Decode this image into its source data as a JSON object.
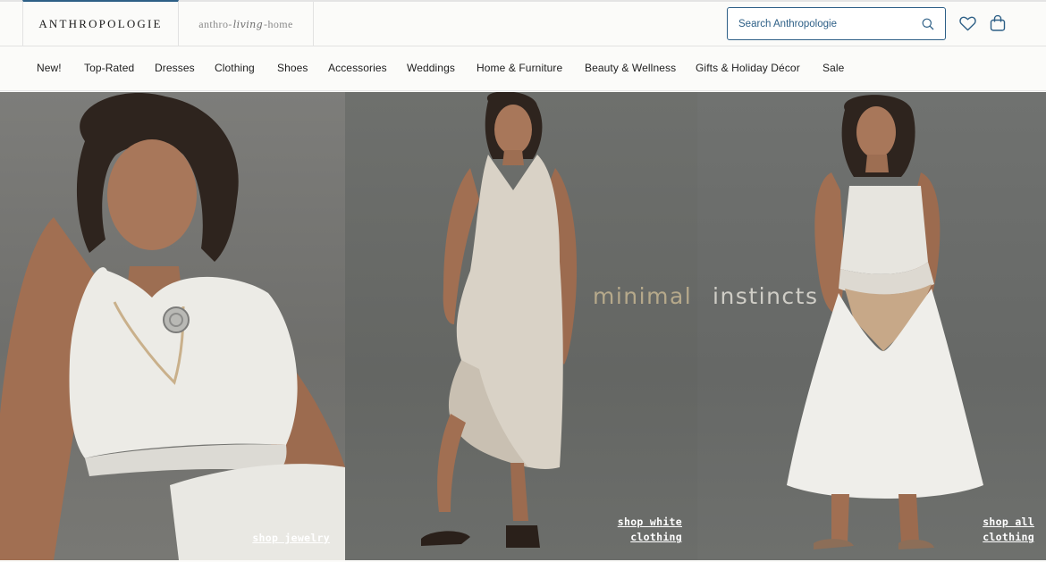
{
  "header": {
    "brand_primary": "ANTHROPOLOGIE",
    "brand_secondary_pre": "anthro-",
    "brand_secondary_script": "living",
    "brand_secondary_post": "-home",
    "search_placeholder": "Search Anthropologie",
    "icons": {
      "search": "search-icon",
      "wishlist": "heart-icon",
      "cart": "shopping-bag-icon"
    },
    "accent_color": "#2d5f86"
  },
  "nav": {
    "items": [
      "New!",
      "Top-Rated",
      "Dresses",
      "Clothing",
      "Shoes",
      "Accessories",
      "Weddings",
      "Home & Furniture",
      "Beauty & Wellness",
      "Gifts & Holiday Décor",
      "Sale"
    ]
  },
  "hero": {
    "headline_left": "minimal",
    "headline_right": "instincts",
    "headline_left_color": "#b6a98b",
    "headline_right_color": "#cfcdc6",
    "links": {
      "jewelry": "shop jewelry",
      "white_line1": "shop white",
      "white_line2": "clothing",
      "all_line1": "shop all",
      "all_line2": "clothing"
    }
  }
}
